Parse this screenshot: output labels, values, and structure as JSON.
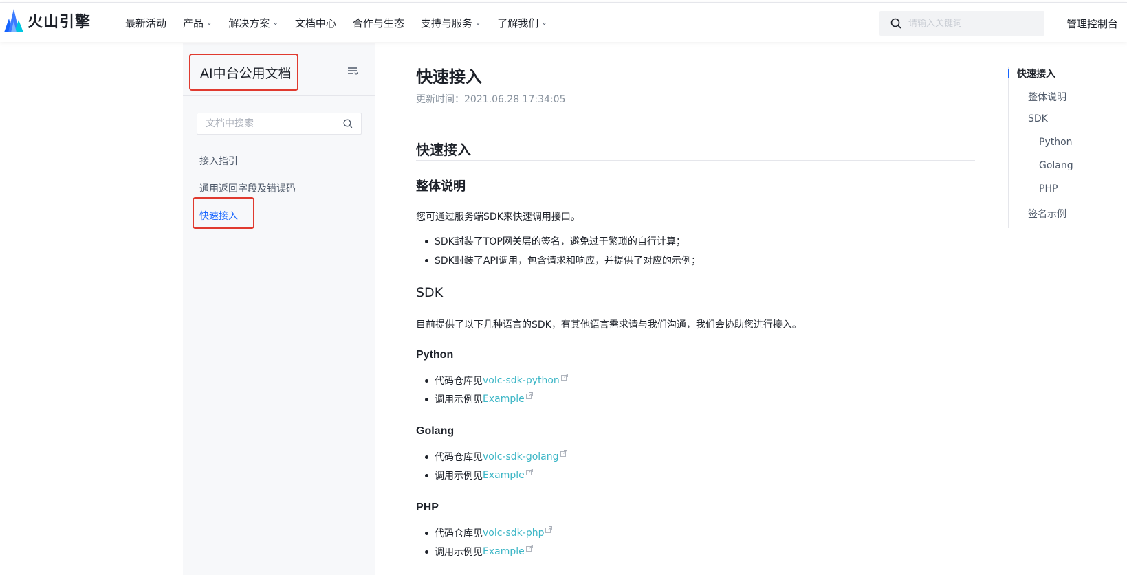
{
  "brand": {
    "name": "火山引擎",
    "colors": {
      "accent": "#1664ff",
      "link": "#3cb6c6",
      "highlight_box": "#e03a2f"
    }
  },
  "nav": {
    "items": [
      {
        "label": "最新活动",
        "has_dropdown": false
      },
      {
        "label": "产品",
        "has_dropdown": true
      },
      {
        "label": "解决方案",
        "has_dropdown": true
      },
      {
        "label": "文档中心",
        "has_dropdown": false
      },
      {
        "label": "合作与生态",
        "has_dropdown": false
      },
      {
        "label": "支持与服务",
        "has_dropdown": true
      },
      {
        "label": "了解我们",
        "has_dropdown": true
      }
    ],
    "search_placeholder": "请输入关键词",
    "console_label": "管理控制台"
  },
  "sidebar": {
    "title": "AI中台公用文档",
    "search_placeholder": "文档中搜索",
    "items": [
      {
        "label": "接入指引",
        "active": false
      },
      {
        "label": "通用返回字段及错误码",
        "active": false
      },
      {
        "label": "快速接入",
        "active": true
      }
    ]
  },
  "article": {
    "title": "快速接入",
    "updated": "更新时间：2021.06.28 17:34:05",
    "section_title": "快速接入",
    "overview": {
      "heading": "整体说明",
      "intro": "您可通过服务端SDK来快速调用接口。",
      "bullets": [
        "SDK封装了TOP网关层的签名，避免过于繁琐的自行计算；",
        "SDK封装了API调用，包含请求和响应，并提供了对应的示例；"
      ]
    },
    "sdk": {
      "heading": "SDK",
      "intro": "目前提供了以下几种语言的SDK，有其他语言需求请与我们沟通，我们会协助您进行接入。",
      "languages": [
        {
          "name": "Python",
          "repo_prefix": "代码仓库见",
          "repo_link": "volc-sdk-python",
          "example_prefix": "调用示例见",
          "example_link": "Example"
        },
        {
          "name": "Golang",
          "repo_prefix": "代码仓库见",
          "repo_link": "volc-sdk-golang",
          "example_prefix": "调用示例见",
          "example_link": "Example"
        },
        {
          "name": "PHP",
          "repo_prefix": "代码仓库见",
          "repo_link": "volc-sdk-php",
          "example_prefix": "调用示例见",
          "example_link": "Example"
        }
      ]
    }
  },
  "toc": {
    "items": [
      {
        "label": "快速接入",
        "level": 1,
        "active": true
      },
      {
        "label": "整体说明",
        "level": 2,
        "active": false
      },
      {
        "label": "SDK",
        "level": 2,
        "active": false
      },
      {
        "label": "Python",
        "level": 3,
        "active": false
      },
      {
        "label": "Golang",
        "level": 3,
        "active": false
      },
      {
        "label": "PHP",
        "level": 3,
        "active": false
      },
      {
        "label": "签名示例",
        "level": 2,
        "active": false
      }
    ]
  },
  "icons": {
    "logo": "volcano-logo-icon",
    "search": "search-icon",
    "chevron": "chevron-down-icon",
    "menu": "menu-collapse-icon",
    "external": "external-link-icon"
  }
}
